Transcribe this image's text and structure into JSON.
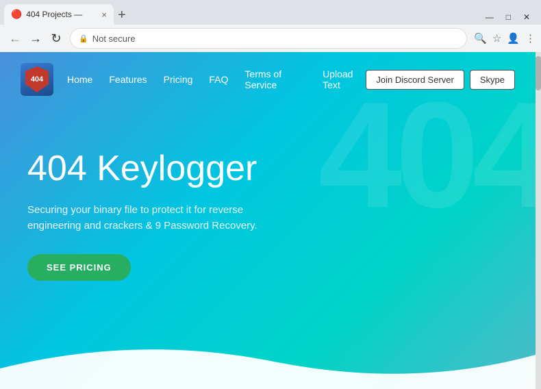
{
  "browser": {
    "tab": {
      "favicon": "🔴",
      "title": "404 Projects —",
      "close": "×"
    },
    "new_tab_label": "+",
    "window_controls": {
      "minimize": "—",
      "maximize": "□",
      "close": "✕"
    },
    "address_bar": {
      "back": "←",
      "forward": "→",
      "refresh": "↻",
      "lock_icon": "🔒",
      "url": "Not secure",
      "search_icon": "🔍",
      "bookmark_icon": "☆",
      "account_icon": "👤",
      "menu_icon": "⋮"
    }
  },
  "navbar": {
    "logo_text": "404",
    "links": [
      {
        "label": "Home",
        "href": "#"
      },
      {
        "label": "Features",
        "href": "#"
      },
      {
        "label": "Pricing",
        "href": "#"
      },
      {
        "label": "FAQ",
        "href": "#"
      },
      {
        "label": "Terms of Service",
        "href": "#"
      },
      {
        "label": "Upload Text",
        "href": "#"
      }
    ],
    "btn_discord": "Join Discord Server",
    "btn_skype": "Skype"
  },
  "hero": {
    "title": "404 Keylogger",
    "subtitle": "Securing your binary file to protect it for reverse engineering and crackers & 9 Password Recovery.",
    "cta_button": "SEE PRICING"
  },
  "watermark": "404"
}
